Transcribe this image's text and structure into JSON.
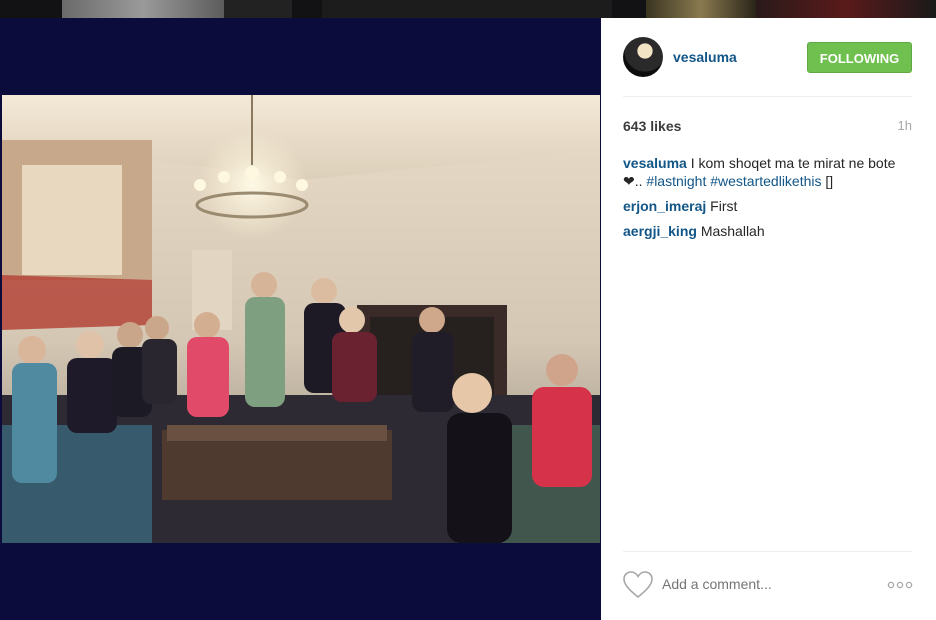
{
  "post": {
    "username": "vesaluma",
    "follow_label": "FOLLOWING",
    "likes": "643 likes",
    "time": "1h",
    "caption": {
      "user": "vesaluma",
      "text": "I kom shoqet ma te mirat ne bote ❤.. ",
      "hashtags": "#lastnight #westartedlikethis",
      "trailing": " []"
    },
    "comments": [
      {
        "user": "erjon_imeraj",
        "text": "First"
      },
      {
        "user": "aergji_king",
        "text": "Mashallah"
      }
    ],
    "add_comment_placeholder": "Add a comment...",
    "icons": {
      "heart": "heart-outline-icon",
      "more": "more-options-icon"
    }
  },
  "colors": {
    "follow_green": "#70c050",
    "link_blue": "#125688",
    "media_background": "#0b0b3c"
  }
}
